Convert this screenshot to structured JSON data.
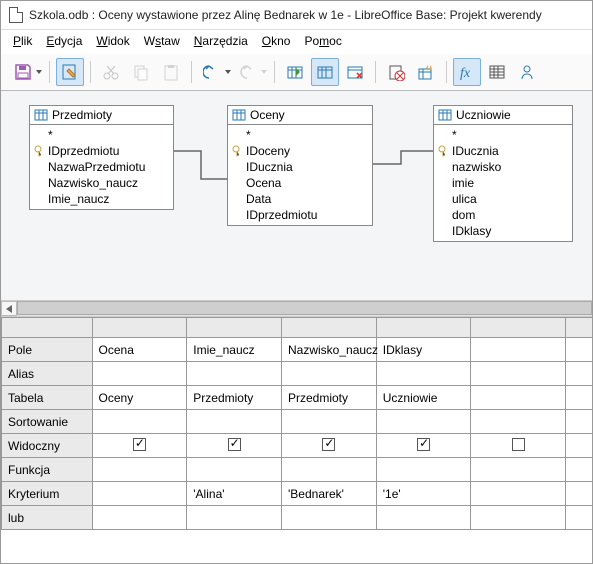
{
  "window": {
    "title": "Szkola.odb : Oceny wystawione przez Alinę Bednarek w 1e - LibreOffice Base: Projekt kwerendy"
  },
  "menu": {
    "plik": "Plik",
    "edycja": "Edycja",
    "widok": "Widok",
    "wstaw": "Wstaw",
    "narzedzia": "Narzędzia",
    "okno": "Okno",
    "pomoc": "Pomoc"
  },
  "tables": {
    "przedmioty": {
      "name": "Przedmioty",
      "star": "*",
      "fields": [
        "IDprzedmiotu",
        "NazwaPrzedmiotu",
        "Nazwisko_naucz",
        "Imie_naucz"
      ]
    },
    "oceny": {
      "name": "Oceny",
      "star": "*",
      "fields": [
        "IDoceny",
        "IDucznia",
        "Ocena",
        "Data",
        "IDprzedmiotu"
      ]
    },
    "uczniowie": {
      "name": "Uczniowie",
      "star": "*",
      "fields": [
        "IDucznia",
        "nazwisko",
        "imie",
        "ulica",
        "dom",
        "IDklasy"
      ]
    }
  },
  "grid": {
    "row_labels": {
      "pole": "Pole",
      "alias": "Alias",
      "tabela": "Tabela",
      "sortowanie": "Sortowanie",
      "widoczny": "Widoczny",
      "funkcja": "Funkcja",
      "kryterium": "Kryterium",
      "lub": "lub"
    },
    "cols": [
      {
        "pole": "Ocena",
        "tabela": "Oceny",
        "widoczny": true,
        "kryterium": ""
      },
      {
        "pole": "Imie_naucz",
        "tabela": "Przedmioty",
        "widoczny": true,
        "kryterium": "'Alina'"
      },
      {
        "pole": "Nazwisko_naucz",
        "tabela": "Przedmioty",
        "widoczny": true,
        "kryterium": "'Bednarek'"
      },
      {
        "pole": "IDklasy",
        "tabela": "Uczniowie",
        "widoczny": true,
        "kryterium": "'1e'"
      },
      {
        "pole": "",
        "tabela": "",
        "widoczny": false,
        "kryterium": ""
      },
      {
        "pole": "",
        "tabela": "",
        "widoczny": false,
        "kryterium": ""
      }
    ]
  }
}
